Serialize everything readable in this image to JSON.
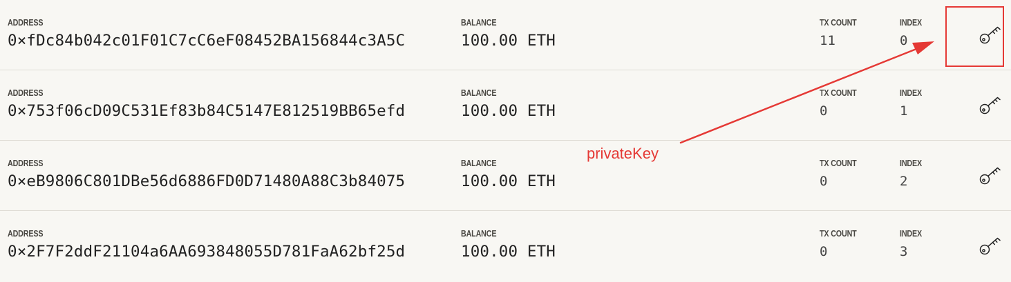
{
  "labels": {
    "address": "ADDRESS",
    "balance": "BALANCE",
    "tx_count": "TX COUNT",
    "index": "INDEX"
  },
  "accounts": [
    {
      "address": "0×fDc84b042c01F01C7cC6eF08452BA156844c3A5C",
      "balance": "100.00 ETH",
      "tx_count": "11",
      "index": "0"
    },
    {
      "address": "0×753f06cD09C531Ef83b84C5147E812519BB65efd",
      "balance": "100.00 ETH",
      "tx_count": "0",
      "index": "1"
    },
    {
      "address": "0×eB9806C801DBe56d6886FD0D71480A88C3b84075",
      "balance": "100.00 ETH",
      "tx_count": "0",
      "index": "2"
    },
    {
      "address": "0×2F7F2ddF21104a6AA693848055D781FaA62bf25d",
      "balance": "100.00 ETH",
      "tx_count": "0",
      "index": "3"
    }
  ],
  "icons": {
    "show_keys": "key-icon"
  },
  "annotation": {
    "text": "privateKey",
    "color": "#e53935"
  }
}
